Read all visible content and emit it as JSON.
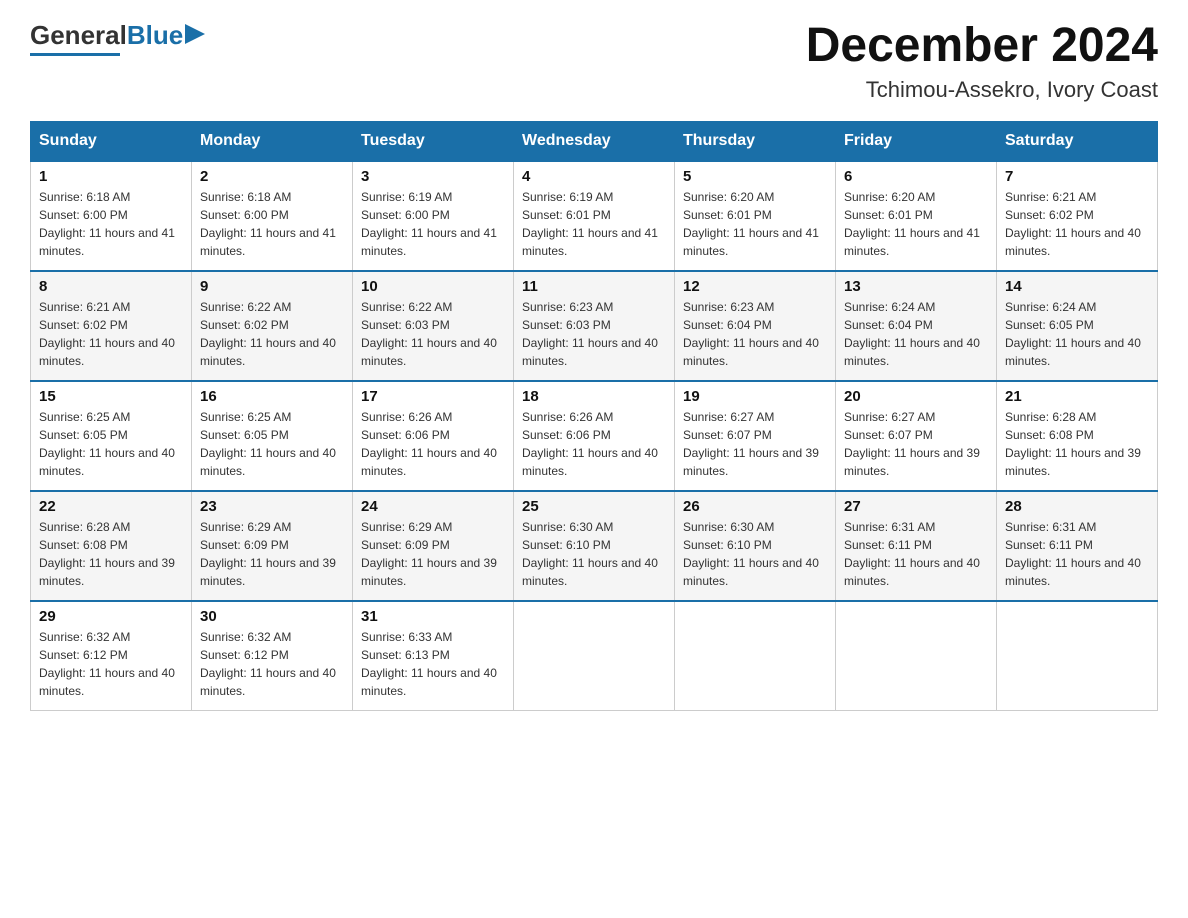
{
  "header": {
    "logo": {
      "general": "General",
      "blue": "Blue"
    },
    "title": "December 2024",
    "location": "Tchimou-Assekro, Ivory Coast"
  },
  "days_of_week": [
    "Sunday",
    "Monday",
    "Tuesday",
    "Wednesday",
    "Thursday",
    "Friday",
    "Saturday"
  ],
  "weeks": [
    [
      {
        "day": "1",
        "sunrise": "6:18 AM",
        "sunset": "6:00 PM",
        "daylight": "11 hours and 41 minutes."
      },
      {
        "day": "2",
        "sunrise": "6:18 AM",
        "sunset": "6:00 PM",
        "daylight": "11 hours and 41 minutes."
      },
      {
        "day": "3",
        "sunrise": "6:19 AM",
        "sunset": "6:00 PM",
        "daylight": "11 hours and 41 minutes."
      },
      {
        "day": "4",
        "sunrise": "6:19 AM",
        "sunset": "6:01 PM",
        "daylight": "11 hours and 41 minutes."
      },
      {
        "day": "5",
        "sunrise": "6:20 AM",
        "sunset": "6:01 PM",
        "daylight": "11 hours and 41 minutes."
      },
      {
        "day": "6",
        "sunrise": "6:20 AM",
        "sunset": "6:01 PM",
        "daylight": "11 hours and 41 minutes."
      },
      {
        "day": "7",
        "sunrise": "6:21 AM",
        "sunset": "6:02 PM",
        "daylight": "11 hours and 40 minutes."
      }
    ],
    [
      {
        "day": "8",
        "sunrise": "6:21 AM",
        "sunset": "6:02 PM",
        "daylight": "11 hours and 40 minutes."
      },
      {
        "day": "9",
        "sunrise": "6:22 AM",
        "sunset": "6:02 PM",
        "daylight": "11 hours and 40 minutes."
      },
      {
        "day": "10",
        "sunrise": "6:22 AM",
        "sunset": "6:03 PM",
        "daylight": "11 hours and 40 minutes."
      },
      {
        "day": "11",
        "sunrise": "6:23 AM",
        "sunset": "6:03 PM",
        "daylight": "11 hours and 40 minutes."
      },
      {
        "day": "12",
        "sunrise": "6:23 AM",
        "sunset": "6:04 PM",
        "daylight": "11 hours and 40 minutes."
      },
      {
        "day": "13",
        "sunrise": "6:24 AM",
        "sunset": "6:04 PM",
        "daylight": "11 hours and 40 minutes."
      },
      {
        "day": "14",
        "sunrise": "6:24 AM",
        "sunset": "6:05 PM",
        "daylight": "11 hours and 40 minutes."
      }
    ],
    [
      {
        "day": "15",
        "sunrise": "6:25 AM",
        "sunset": "6:05 PM",
        "daylight": "11 hours and 40 minutes."
      },
      {
        "day": "16",
        "sunrise": "6:25 AM",
        "sunset": "6:05 PM",
        "daylight": "11 hours and 40 minutes."
      },
      {
        "day": "17",
        "sunrise": "6:26 AM",
        "sunset": "6:06 PM",
        "daylight": "11 hours and 40 minutes."
      },
      {
        "day": "18",
        "sunrise": "6:26 AM",
        "sunset": "6:06 PM",
        "daylight": "11 hours and 40 minutes."
      },
      {
        "day": "19",
        "sunrise": "6:27 AM",
        "sunset": "6:07 PM",
        "daylight": "11 hours and 39 minutes."
      },
      {
        "day": "20",
        "sunrise": "6:27 AM",
        "sunset": "6:07 PM",
        "daylight": "11 hours and 39 minutes."
      },
      {
        "day": "21",
        "sunrise": "6:28 AM",
        "sunset": "6:08 PM",
        "daylight": "11 hours and 39 minutes."
      }
    ],
    [
      {
        "day": "22",
        "sunrise": "6:28 AM",
        "sunset": "6:08 PM",
        "daylight": "11 hours and 39 minutes."
      },
      {
        "day": "23",
        "sunrise": "6:29 AM",
        "sunset": "6:09 PM",
        "daylight": "11 hours and 39 minutes."
      },
      {
        "day": "24",
        "sunrise": "6:29 AM",
        "sunset": "6:09 PM",
        "daylight": "11 hours and 39 minutes."
      },
      {
        "day": "25",
        "sunrise": "6:30 AM",
        "sunset": "6:10 PM",
        "daylight": "11 hours and 40 minutes."
      },
      {
        "day": "26",
        "sunrise": "6:30 AM",
        "sunset": "6:10 PM",
        "daylight": "11 hours and 40 minutes."
      },
      {
        "day": "27",
        "sunrise": "6:31 AM",
        "sunset": "6:11 PM",
        "daylight": "11 hours and 40 minutes."
      },
      {
        "day": "28",
        "sunrise": "6:31 AM",
        "sunset": "6:11 PM",
        "daylight": "11 hours and 40 minutes."
      }
    ],
    [
      {
        "day": "29",
        "sunrise": "6:32 AM",
        "sunset": "6:12 PM",
        "daylight": "11 hours and 40 minutes."
      },
      {
        "day": "30",
        "sunrise": "6:32 AM",
        "sunset": "6:12 PM",
        "daylight": "11 hours and 40 minutes."
      },
      {
        "day": "31",
        "sunrise": "6:33 AM",
        "sunset": "6:13 PM",
        "daylight": "11 hours and 40 minutes."
      },
      null,
      null,
      null,
      null
    ]
  ]
}
